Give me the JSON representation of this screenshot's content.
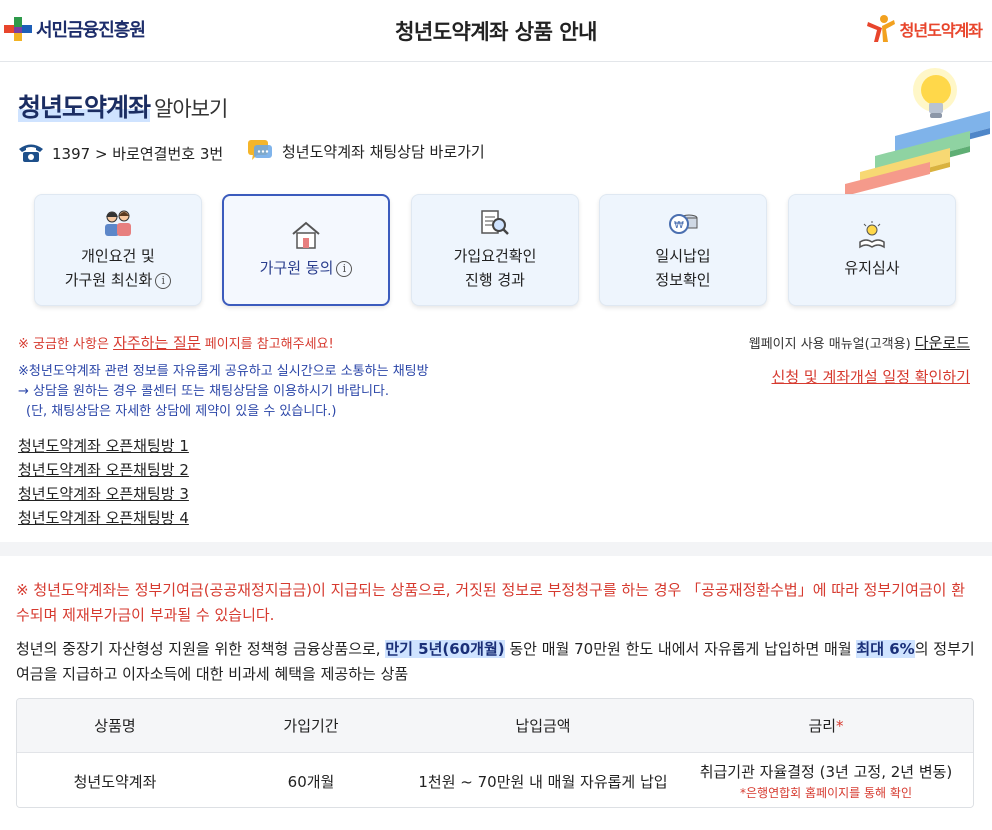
{
  "header": {
    "left_logo_text": "서민금융진흥원",
    "title": "청년도약계좌 상품 안내",
    "right_logo_text": "청년도약계좌"
  },
  "intro": {
    "title_highlight": "청년도약계좌",
    "title_rest": "알아보기",
    "phone_text": "1397 > 바로연결번호 3번",
    "chat_link": "청년도약계좌 채팅상담 바로가기"
  },
  "steps": [
    {
      "line1": "개인요건 및",
      "line2": "가구원 최신화",
      "info": "i",
      "active": false
    },
    {
      "line1": "가구원 동의",
      "line2": "",
      "info": "i",
      "active": true
    },
    {
      "line1": "가입요건확인",
      "line2": "진행 경과",
      "info": "",
      "active": false
    },
    {
      "line1": "일시납입",
      "line2": "정보확인",
      "info": "",
      "active": false
    },
    {
      "line1": "유지심사",
      "line2": "",
      "info": "",
      "active": false
    }
  ],
  "notices": {
    "faq_prefix": "※ 궁금한 사항은 ",
    "faq_link": "자주하는 질문",
    "faq_suffix": " 페이지를 참고해주세요!",
    "manual_prefix": "웹페이지 사용 매뉴얼(고객용) ",
    "manual_link": "다운로드",
    "schedule_link": "신청 및 계좌개설 일정 확인하기",
    "chat_line1": "※청년도약계좌 관련 정보를 자유롭게 공유하고 실시간으로 소통하는 채팅방",
    "chat_line2": "→ 상담을 원하는 경우 콜센터 또는 채팅상담을 이용하시기 바랍니다.",
    "chat_line3": "(단, 채팅상담은 자세한 상담에 제약이 있을 수 있습니다.)"
  },
  "chat_rooms": [
    "청년도약계좌 오픈채팅방 1",
    "청년도약계좌 오픈채팅방 2",
    "청년도약계좌 오픈채팅방 3",
    "청년도약계좌 오픈채팅방 4"
  ],
  "warning": "※ 청년도약계좌는 정부기여금(공공재정지급금)이 지급되는 상품으로, 거짓된 정보로 부정청구를 하는 경우 「공공재정환수법」에 따라 정부기여금이 환수되며 제재부가금이 부과될 수 있습니다.",
  "description": {
    "part1": "청년의 중장기 자산형성 지원을 위한 정책형 금융상품으로, ",
    "hl1": "만기 5년(60개월)",
    "part2": " 동안 매월 70만원 한도 내에서 자유롭게 납입하면 매월 ",
    "hl2": "최대 6%",
    "part3": "의 정부기여금을 지급하고 이자소득에 대한 비과세 혜택을 제공하는 상품"
  },
  "table": {
    "headers": [
      "상품명",
      "가입기간",
      "납입금액",
      "금리"
    ],
    "rate_marker": "*",
    "row": [
      "청년도약계좌",
      "60개월",
      "1천원 ~ 70만원 내 매월 자유롭게 납입",
      "취급기관 자율결정 (3년 고정, 2년 변동)"
    ],
    "rate_note": "*은행연합회 홈페이지를 통해 확인"
  },
  "colors": {
    "navy": "#1b2d62",
    "accent_blue": "#3b5bbd",
    "red": "#d63a2f",
    "card_bg": "#eef5fd",
    "highlight": "#cfe3ff"
  }
}
